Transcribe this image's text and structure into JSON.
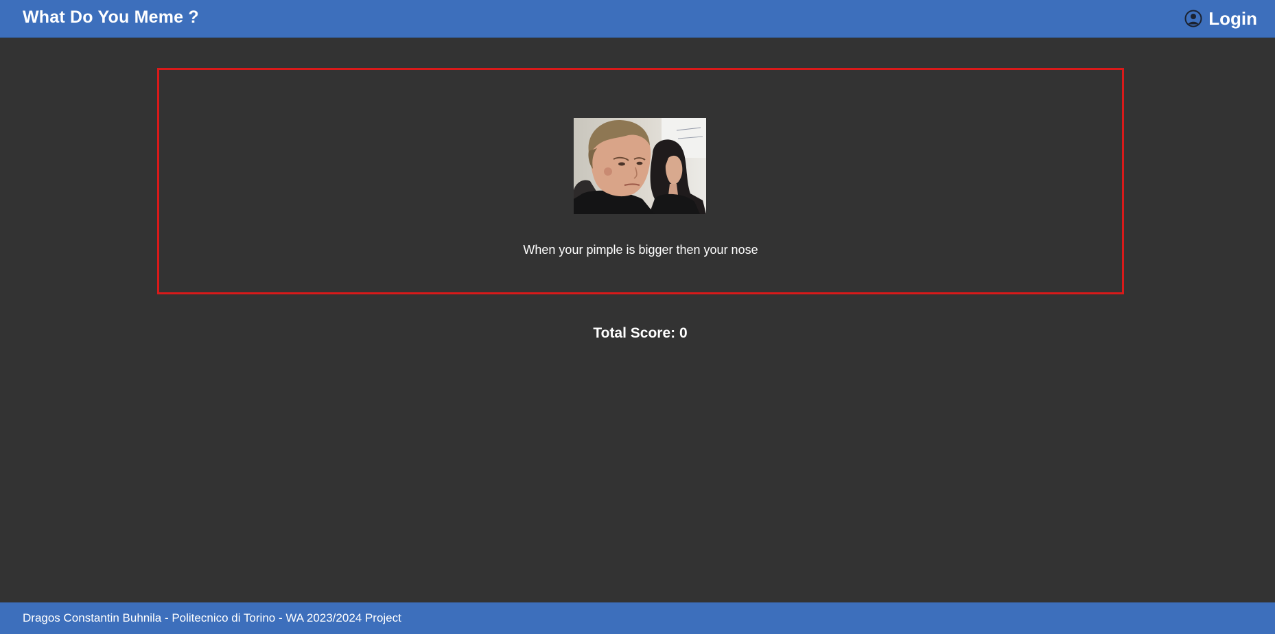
{
  "header": {
    "title": "What Do You Meme ?",
    "login_label": "Login",
    "login_icon": "user-circle-icon"
  },
  "meme": {
    "image_icon": "meme-photo",
    "caption": "When your pimple is bigger then your nose",
    "border_color": "#d91a1a"
  },
  "score": {
    "text": "Total Score: 0"
  },
  "footer": {
    "text": "Dragos Constantin Buhnila - Politecnico di Torino - WA 2023/2024 Project"
  },
  "colors": {
    "bar": "#3d6fbc",
    "background": "#333333",
    "text": "#ffffff"
  }
}
